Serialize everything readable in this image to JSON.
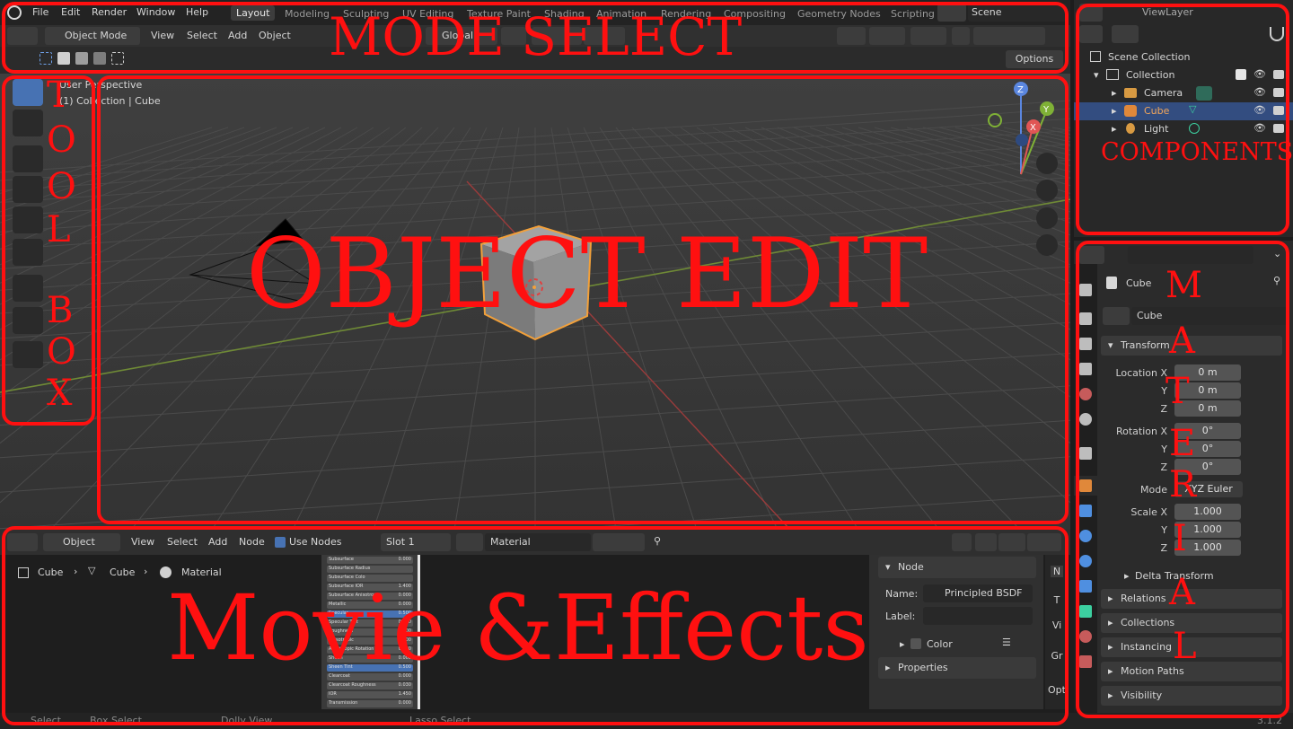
{
  "app": {
    "menus": [
      "File",
      "Edit",
      "Render",
      "Window",
      "Help"
    ],
    "workspace_tabs": [
      "Layout",
      "Modeling",
      "Sculpting",
      "UV Editing",
      "Texture Paint",
      "Shading",
      "Animation",
      "Rendering",
      "Compositing",
      "Geometry Nodes",
      "Scripting"
    ],
    "scene": "Scene",
    "view_layer": "ViewLayer"
  },
  "viewport": {
    "mode": "Object Mode",
    "menus": [
      "View",
      "Select",
      "Add",
      "Object"
    ],
    "transform_orientation": "Global",
    "options": "Options",
    "overlay_line1": "User Perspective",
    "overlay_line2": "(1) Collection | Cube",
    "gizmo_axes": [
      "Z",
      "Y",
      "X"
    ]
  },
  "outliner": {
    "root": "Scene Collection",
    "collection": "Collection",
    "items": [
      "Camera",
      "Cube",
      "Light"
    ],
    "selected": "Cube"
  },
  "properties": {
    "object_name": "Cube",
    "data_name": "Cube",
    "transform_header": "Transform",
    "location_label": "Location X",
    "rotation_label": "Rotation X",
    "scale_label": "Scale X",
    "axis_y": "Y",
    "axis_z": "Z",
    "location": [
      "0 m",
      "0 m",
      "0 m"
    ],
    "rotation": [
      "0°",
      "0°",
      "0°"
    ],
    "mode_label": "Mode",
    "mode_value": "XYZ Euler",
    "scale": [
      "1.000",
      "1.000",
      "1.000"
    ],
    "delta": "Delta Transform",
    "sections": [
      "Relations",
      "Collections",
      "Instancing",
      "Motion Paths",
      "Visibility"
    ]
  },
  "node_editor": {
    "type": "Object",
    "menus": [
      "View",
      "Select",
      "Add",
      "Node"
    ],
    "use_nodes": "Use Nodes",
    "slot": "Slot 1",
    "material": "Material",
    "breadcrumb": [
      "Cube",
      "Cube",
      "Material"
    ],
    "node_panel": "Node",
    "name_label": "Name:",
    "name_value": "Principled BSDF",
    "label_label": "Label:",
    "color": "Color",
    "properties": "Properties",
    "side_tabs": [
      "N",
      "T",
      "Vi",
      "Gr",
      "Opt"
    ],
    "bsdf_rows": [
      "Subsurface",
      "Subsurface Radius",
      "Subsurface Colo",
      "Subsurface IOR",
      "Subsurface Anisotropy",
      "Metallic",
      "Specular",
      "Specular Tint",
      "Roughness",
      "Anisotropic",
      "Anisotropic Rotation",
      "Sheen",
      "Sheen Tint",
      "Clearcoat",
      "Clearcoat Roughness",
      "IOR",
      "Transmission"
    ],
    "bsdf_values": [
      "0.000",
      "",
      "",
      "1.400",
      "0.000",
      "0.000",
      "0.500",
      "0.000",
      "0.500",
      "0.000",
      "0.000",
      "0.000",
      "0.500",
      "0.000",
      "0.030",
      "1.450",
      "0.000"
    ]
  },
  "statusbar": {
    "items": [
      "Select",
      "Box Select",
      "Dolly View",
      "Lasso Select"
    ],
    "version": "3.1.2"
  },
  "annotations": {
    "mode_select": "MODE SELECT",
    "components": "COMPONENTS",
    "object_edit": "OBJECT EDIT",
    "movie_effects": "Movie &Effects",
    "toolbox_letters": [
      "T",
      "O",
      "O",
      "L",
      "B",
      "O",
      "X"
    ],
    "material_letters": [
      "M",
      "A",
      "T",
      "E",
      "R",
      "I",
      "A",
      "L"
    ],
    "color": "#ff1010"
  }
}
